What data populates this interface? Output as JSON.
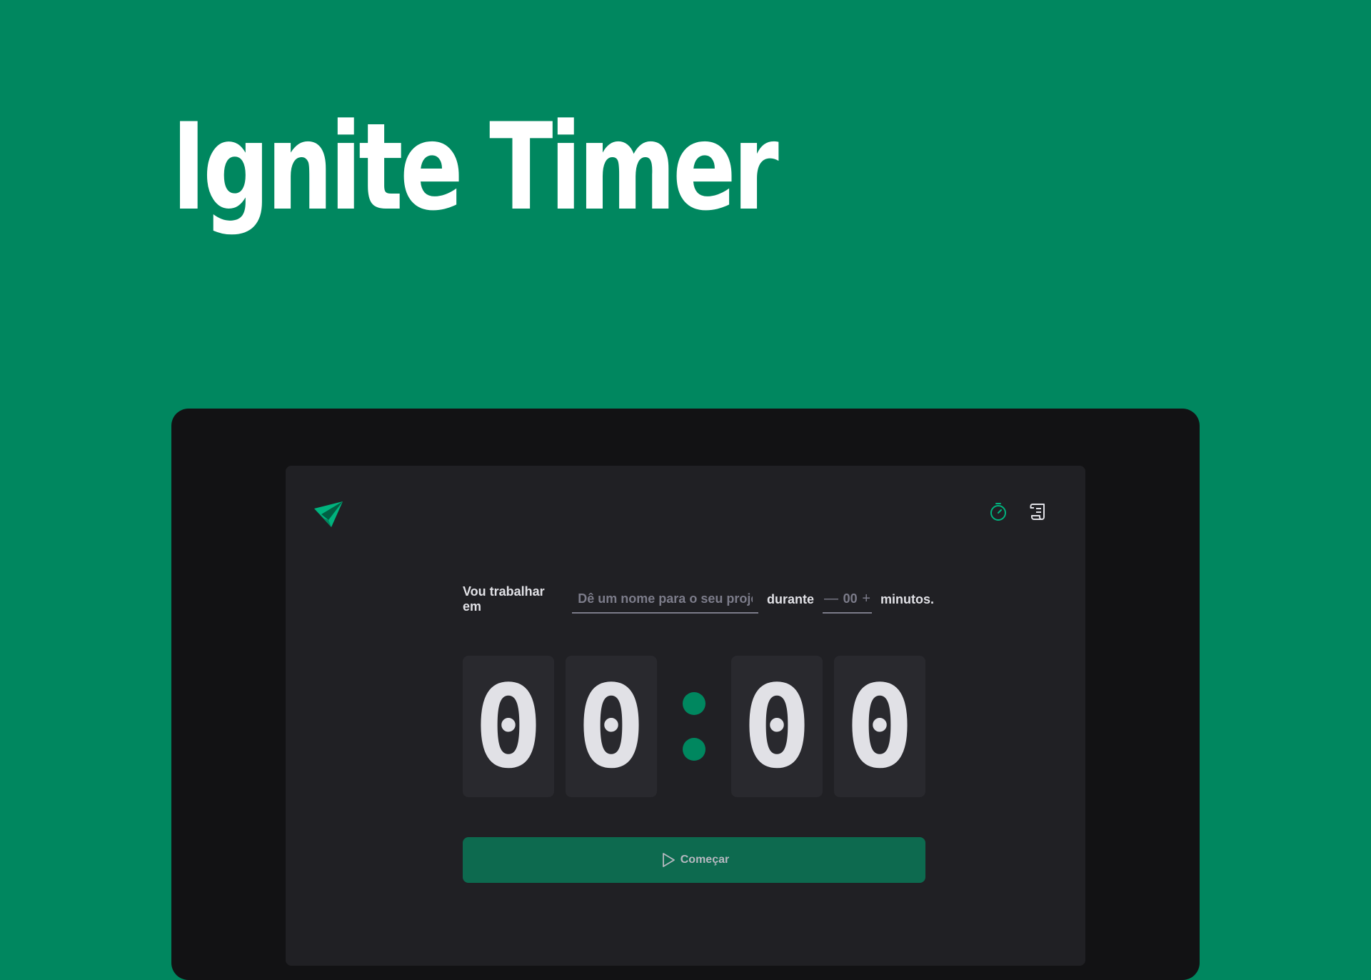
{
  "hero": {
    "title": "Ignite Timer"
  },
  "app": {
    "nav": [
      {
        "icon": "timer-icon",
        "active": true
      },
      {
        "icon": "scroll-icon",
        "active": false
      }
    ],
    "form": {
      "label_start": "Vou trabalhar em",
      "task_placeholder": "Dê um nome para o seu projeto",
      "task_value": "",
      "label_middle": "durante",
      "minus_symbol": "—",
      "plus_symbol": "+",
      "minutes_value": "00",
      "label_end": "minutos."
    },
    "countdown": {
      "minutes_tens": "0",
      "minutes_ones": "0",
      "seconds_tens": "0",
      "seconds_ones": "0"
    },
    "start_button": {
      "label": "Começar",
      "icon": "play-icon"
    }
  },
  "colors": {
    "background": "#00875F",
    "device": "#121214",
    "app": "#202024",
    "digit_box": "#29292E",
    "accent": "#00875F",
    "button": "#0D6A4F",
    "text": "#E1E1E6",
    "muted": "#7C7C8A"
  }
}
